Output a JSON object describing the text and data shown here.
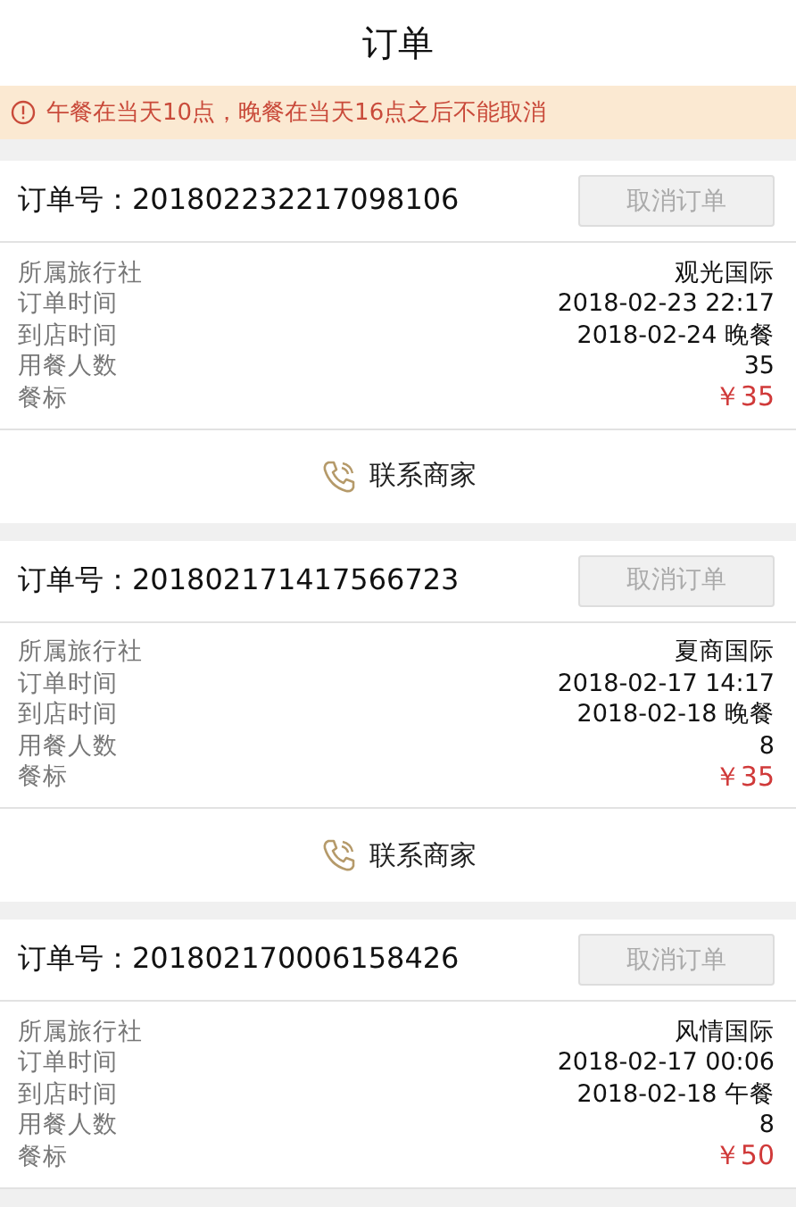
{
  "title": "订单",
  "notice": {
    "text": "午餐在当天10点，晚餐在当天16点之后不能取消"
  },
  "orders": [
    {
      "order_no": "订单号：201802232217098106",
      "cancel": {
        "label": "取消订单",
        "disabled": true
      },
      "details": [
        {
          "kind": "text",
          "label": "所属旅行社",
          "value": "观光国际"
        },
        {
          "kind": "text",
          "label": "订单时间",
          "value": "2018-02-23 22:17"
        },
        {
          "kind": "text",
          "label": "到店时间",
          "value": "2018-02-24 晚餐"
        },
        {
          "kind": "text",
          "label": "用餐人数",
          "value": "35"
        },
        {
          "kind": "price",
          "label": "餐标",
          "value": "￥35"
        }
      ],
      "contact": "联系商家"
    },
    {
      "order_no": "订单号：201802171417566723",
      "cancel": {
        "label": "取消订单",
        "disabled": true
      },
      "details": [
        {
          "kind": "text",
          "label": "所属旅行社",
          "value": "夏商国际"
        },
        {
          "kind": "text",
          "label": "订单时间",
          "value": "2018-02-17 14:17"
        },
        {
          "kind": "text",
          "label": "到店时间",
          "value": "2018-02-18 晚餐"
        },
        {
          "kind": "text",
          "label": "用餐人数",
          "value": "8"
        },
        {
          "kind": "price",
          "label": "餐标",
          "value": "￥35"
        }
      ],
      "contact": "联系商家"
    },
    {
      "order_no": "订单号：201802170006158426",
      "cancel": {
        "label": "取消订单",
        "disabled": true
      },
      "details": [
        {
          "kind": "text",
          "label": "所属旅行社",
          "value": "风情国际"
        },
        {
          "kind": "text",
          "label": "订单时间",
          "value": "2018-02-17 00:06"
        },
        {
          "kind": "text",
          "label": "到店时间",
          "value": "2018-02-18 午餐"
        },
        {
          "kind": "text",
          "label": "用餐人数",
          "value": "8"
        },
        {
          "kind": "price",
          "label": "餐标",
          "value": "￥50"
        }
      ]
    }
  ]
}
